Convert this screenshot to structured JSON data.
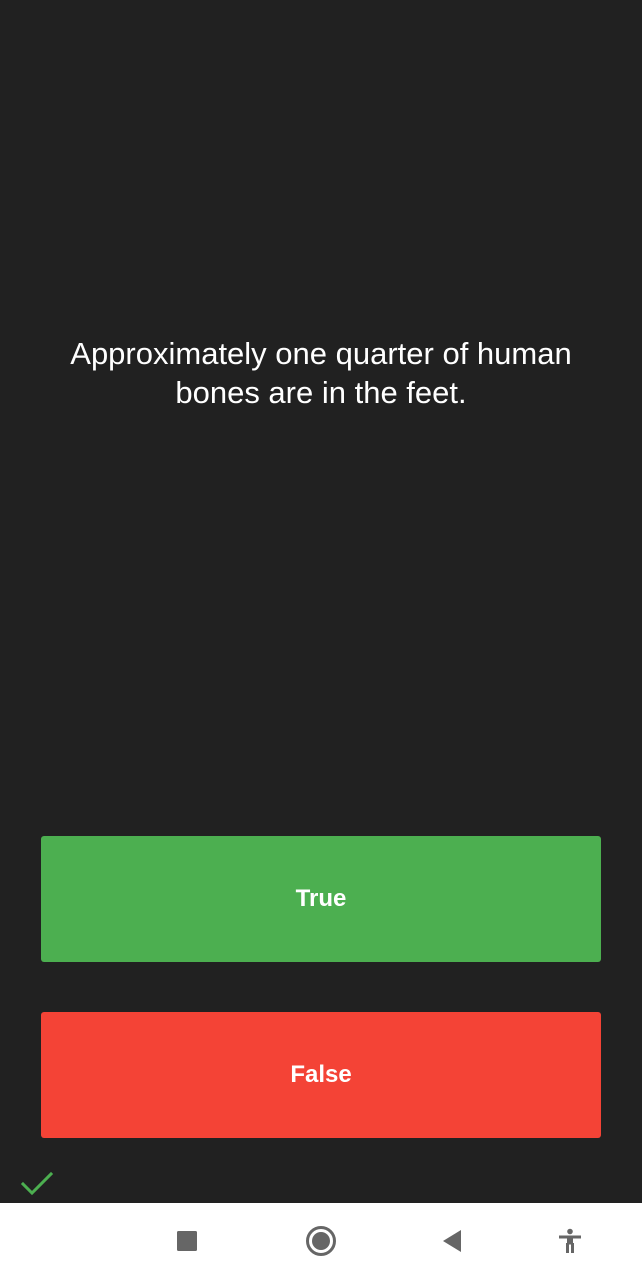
{
  "question": {
    "text": "Approximately one quarter of human bones are in the feet."
  },
  "answers": {
    "true_label": "True",
    "false_label": "False",
    "true_color": "#4caf50",
    "false_color": "#f44336"
  },
  "status": {
    "icon": "checkmark-icon",
    "color": "#4caf50"
  },
  "navbar": {
    "icons": [
      "recents-square-icon",
      "home-circle-icon",
      "back-triangle-icon",
      "accessibility-icon"
    ]
  }
}
